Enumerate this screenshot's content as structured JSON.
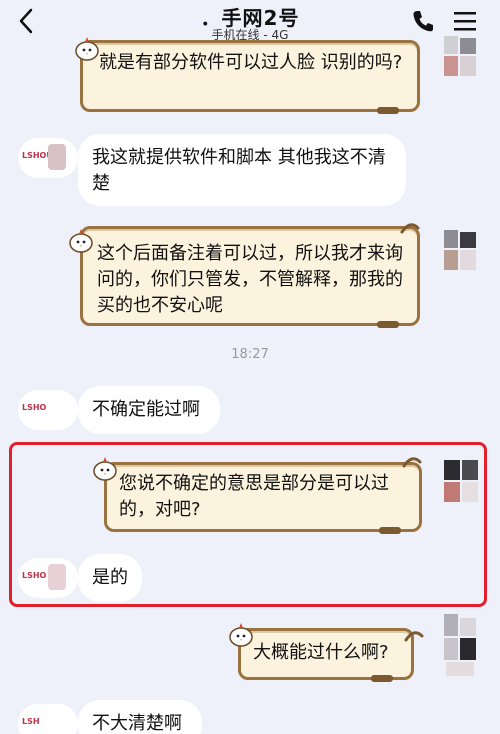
{
  "header": {
    "title": "．手网2号",
    "status": "手机在线 - 4G",
    "back_icon": "chevron-left-icon",
    "call_icon": "phone-icon",
    "menu_icon": "hamburger-menu-icon"
  },
  "messages": [
    {
      "side": "right",
      "style": "paper",
      "text": "就是有部分软件可以过人脸  识别的吗?"
    },
    {
      "side": "left",
      "style": "white",
      "avatar_tag": "LSHOU",
      "text": "我这就提供软件和脚本  其他我这不清楚"
    },
    {
      "side": "right",
      "style": "paper",
      "text": "这个后面备注着可以过，所以我才来询问的，你们只管发，不管解释，那我的买的也不安心呢"
    },
    {
      "side": "left",
      "style": "white",
      "avatar_tag": "LSHO",
      "text": "不确定能过啊"
    },
    {
      "side": "right",
      "style": "paper",
      "text": "您说不确定的意思是部分是可以过的，对吧?"
    },
    {
      "side": "left",
      "style": "white",
      "avatar_tag": "LSHO",
      "text": "是的"
    },
    {
      "side": "right",
      "style": "paper",
      "text": "大概能过什么啊?"
    },
    {
      "side": "left",
      "style": "white",
      "avatar_tag": "LSH",
      "text": "不大清楚啊"
    }
  ],
  "timestamp": "18:27",
  "colors": {
    "background": "#eef1fa",
    "highlight": "#e0202a",
    "paper_fill": "#fbf3dd",
    "paper_border": "#9a7240",
    "bubble_white": "#ffffff"
  }
}
